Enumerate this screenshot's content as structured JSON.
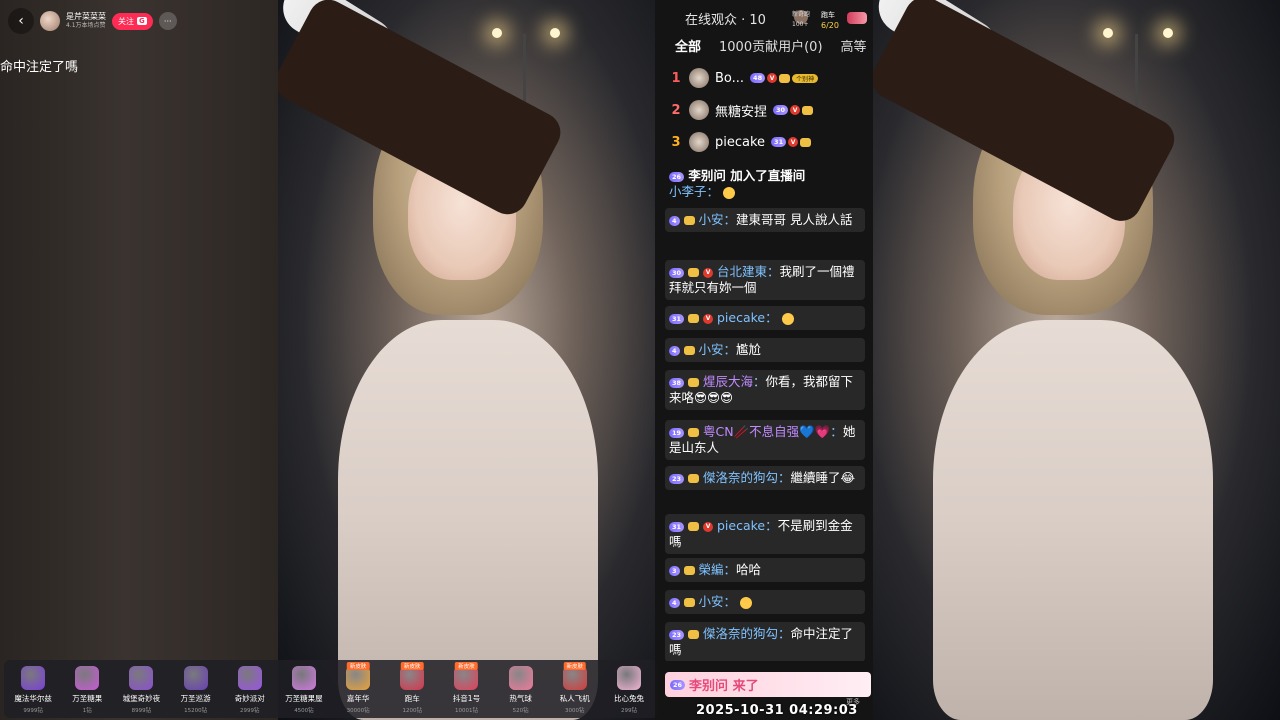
{
  "streamer": {
    "name": "是芹菜菜菜",
    "sub": "4.1万本场点赞",
    "follow_label": "关注",
    "follow_badge": "G",
    "more": "···"
  },
  "left_caption": "命中注定了嗎",
  "panel": {
    "viewers_label": "在线观众 · 10",
    "car_label": "跑车",
    "car_count": "6/20",
    "tiny1": "新奇跑",
    "tiny2": "100+",
    "tabs": [
      {
        "label": "全部",
        "active": true
      },
      {
        "label": "1000贡献用户(0)",
        "active": false
      },
      {
        "label": "高等",
        "active": false
      }
    ],
    "ranks": [
      {
        "rank": "1",
        "name": "Bo...",
        "level": "48",
        "tag": "个别神",
        "color": "#ff5a5a"
      },
      {
        "rank": "2",
        "name": "無糖安捏",
        "level": "30",
        "tag": "",
        "color": "#ff6b6b"
      },
      {
        "rank": "3",
        "name": "piecake",
        "level": "31",
        "tag": "",
        "color": "#ffb020"
      }
    ]
  },
  "chat": [
    {
      "level": "26",
      "name": "",
      "text": "李别问 加入了直播间",
      "system": true
    },
    {
      "level": "",
      "name": "小李子",
      "text": "",
      "emoji": true
    },
    {
      "level": "4",
      "name": "小安",
      "text": "建東哥哥 見人說人話"
    },
    {
      "level": "30",
      "name": "台北建東",
      "text": "我刷了一個禮拜就只有妳一個",
      "vip": true
    },
    {
      "level": "31",
      "name": "piecake",
      "text": "",
      "vip": true,
      "emoji": true
    },
    {
      "level": "4",
      "name": "小安",
      "text": "尷尬"
    },
    {
      "level": "38",
      "name": "煋辰大海",
      "text": "你看，我都留下来咯😎😎😎",
      "purple": true
    },
    {
      "level": "19",
      "name": "粤CN🥢不息自强💙💗",
      "text": "她是山东人",
      "purple": true
    },
    {
      "level": "23",
      "name": "傑洛奈的狗勾",
      "text": "繼續睡了😂"
    },
    {
      "level": "31",
      "name": "piecake",
      "text": "不是刷到金金嗎",
      "vip": true
    },
    {
      "level": "3",
      "name": "榮編",
      "text": "哈哈"
    },
    {
      "level": "4",
      "name": "小安",
      "text": "",
      "emoji": true
    },
    {
      "level": "23",
      "name": "傑洛奈的狗勾",
      "text": "命中注定了嗎"
    }
  ],
  "join": {
    "level": "26",
    "text": "李别问 来了"
  },
  "timestamp": "2025-10-31 04:29:03",
  "more_label": "更多",
  "gifts": [
    {
      "name": "魔法华尔兹",
      "price": "9999钻",
      "tag": "",
      "color": "#7a3fd9"
    },
    {
      "name": "万圣糖果",
      "price": "1钻",
      "tag": "",
      "color": "#c95ad8"
    },
    {
      "name": "城堡奇妙夜",
      "price": "8999钻",
      "tag": "",
      "color": "#8b4fd0"
    },
    {
      "name": "万圣巡游",
      "price": "15200钻",
      "tag": "",
      "color": "#6a3fb5"
    },
    {
      "name": "奇妙派对",
      "price": "2999钻",
      "tag": "",
      "color": "#9b54e6"
    },
    {
      "name": "万圣糖果屋",
      "price": "4500钻",
      "tag": "",
      "color": "#d07ae0"
    },
    {
      "name": "嘉年华",
      "price": "30000钻",
      "tag": "新皮肤",
      "color": "#e8a33a"
    },
    {
      "name": "跑车",
      "price": "1200钻",
      "tag": "新皮肤",
      "color": "#d8344b"
    },
    {
      "name": "抖音1号",
      "price": "10001钻",
      "tag": "新皮肤",
      "color": "#e0405a"
    },
    {
      "name": "热气球",
      "price": "520钻",
      "tag": "",
      "color": "#f07a9a"
    },
    {
      "name": "私人飞机",
      "price": "3000钻",
      "tag": "新皮肤",
      "color": "#d23b3b"
    },
    {
      "name": "比心兔兔",
      "price": "299钻",
      "tag": "",
      "color": "#f3b6d6"
    }
  ]
}
